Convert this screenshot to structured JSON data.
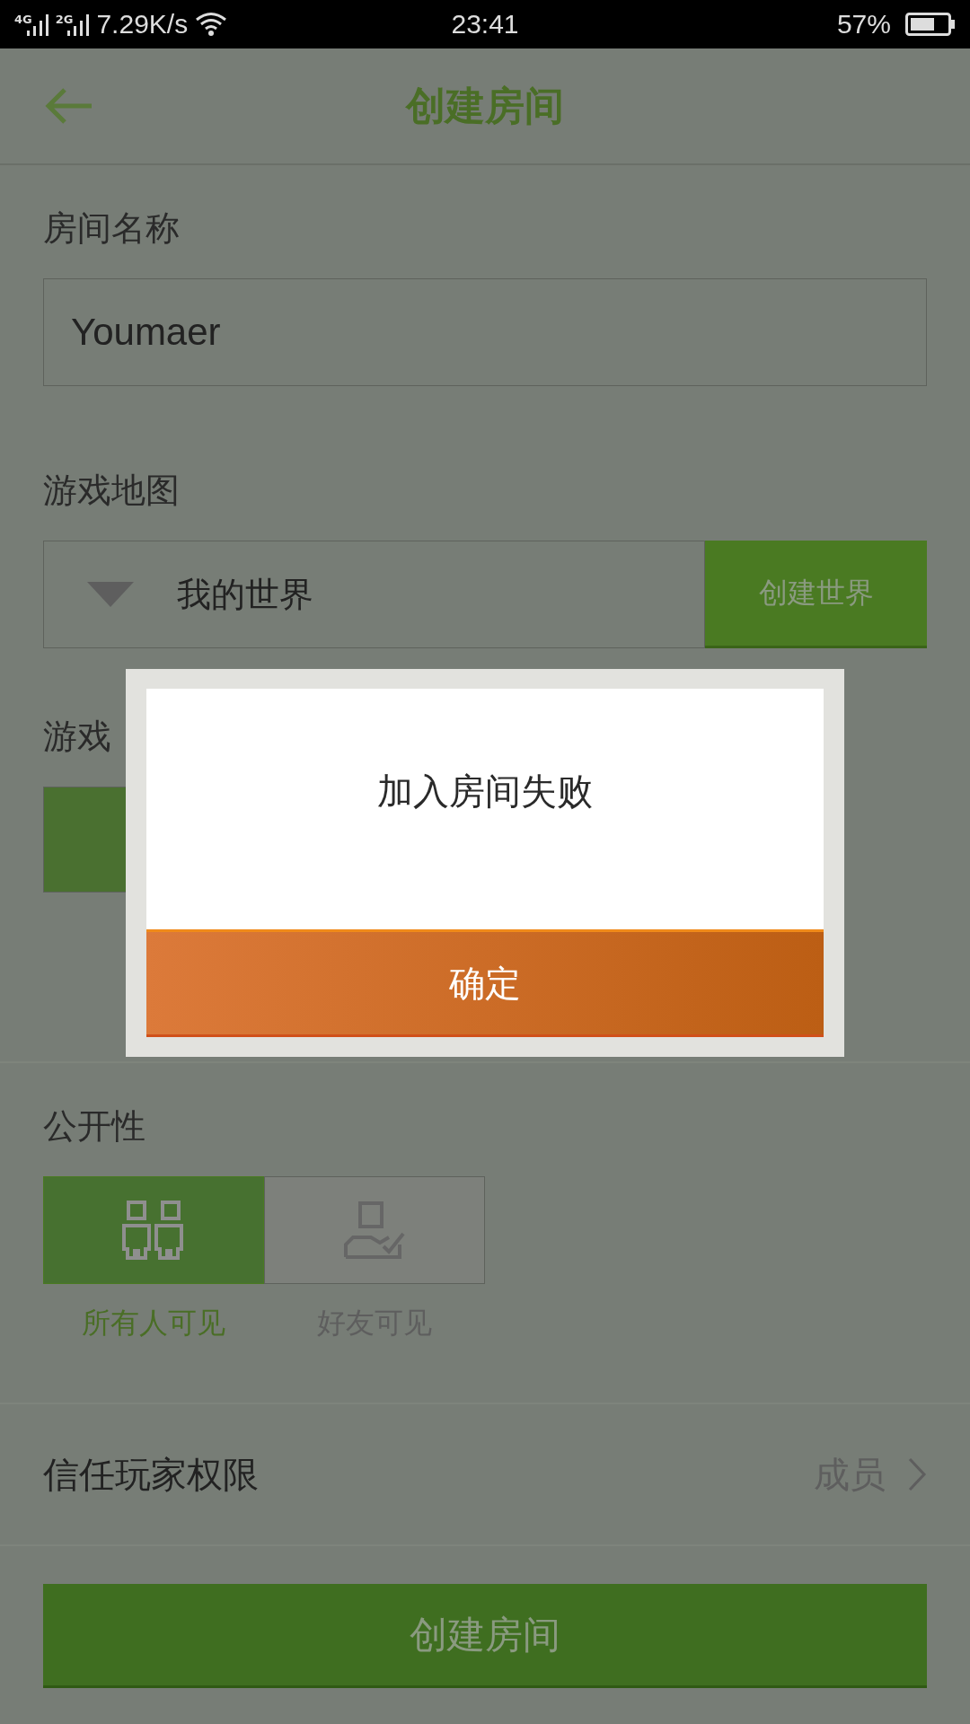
{
  "status_bar": {
    "signals": [
      {
        "label": "4G"
      },
      {
        "label": "2G"
      }
    ],
    "speed": "7.29K/s",
    "time": "23:41",
    "battery": "57%"
  },
  "header": {
    "title": "创建房间"
  },
  "room_name": {
    "label": "房间名称",
    "value": "Youmaer"
  },
  "game_map": {
    "label": "游戏地图",
    "value": "我的世界",
    "button": "创建世界"
  },
  "game_mode": {
    "label": "游戏",
    "options": [
      {
        "selected": true
      }
    ]
  },
  "visibility": {
    "label": "公开性",
    "options": [
      {
        "kind": "everyone",
        "label": "所有人可见",
        "selected": true
      },
      {
        "kind": "friends",
        "label": "好友可见",
        "selected": false
      }
    ]
  },
  "trust": {
    "label": "信任玩家权限",
    "value": "成员"
  },
  "create_button": "创建房间",
  "dialog": {
    "message": "加入房间失败",
    "button": "确定"
  }
}
